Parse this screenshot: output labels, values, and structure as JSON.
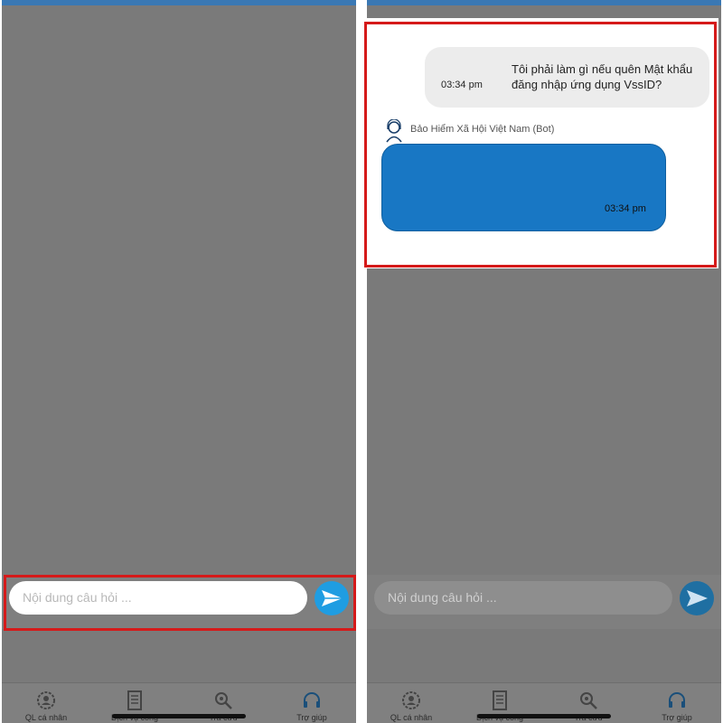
{
  "left": {
    "input": {
      "placeholder": "Nội dung câu hỏi ..."
    },
    "tabs": [
      {
        "label": "QL cá nhân",
        "icon": "personal-gear-icon"
      },
      {
        "label": "Dịch vụ công",
        "icon": "document-icon"
      },
      {
        "label": "Tra cứu",
        "icon": "search-gear-icon"
      },
      {
        "label": "Trợ giúp",
        "icon": "headset-icon"
      }
    ]
  },
  "right": {
    "chat": {
      "user_message": "Tôi phải làm gì nếu quên Mật khẩu đăng nhập ứng dụng VssID?",
      "user_time": "03:34 pm",
      "bot_name": "Bảo Hiểm Xã Hội Việt Nam (Bot)",
      "bot_time": "03:34 pm"
    },
    "input": {
      "placeholder": "Nội dung câu hỏi ..."
    },
    "tabs": [
      {
        "label": "QL cá nhân",
        "icon": "personal-gear-icon"
      },
      {
        "label": "Dịch vụ công",
        "icon": "document-icon"
      },
      {
        "label": "Tra cứu",
        "icon": "search-gear-icon"
      },
      {
        "label": "Trợ giúp",
        "icon": "headset-icon"
      }
    ]
  },
  "colors": {
    "overlay": "#7a7a7a",
    "highlight": "#d51a1a",
    "send_button": "#1f9de2",
    "bot_bubble": "#1877c4",
    "user_bubble": "#ececec"
  }
}
